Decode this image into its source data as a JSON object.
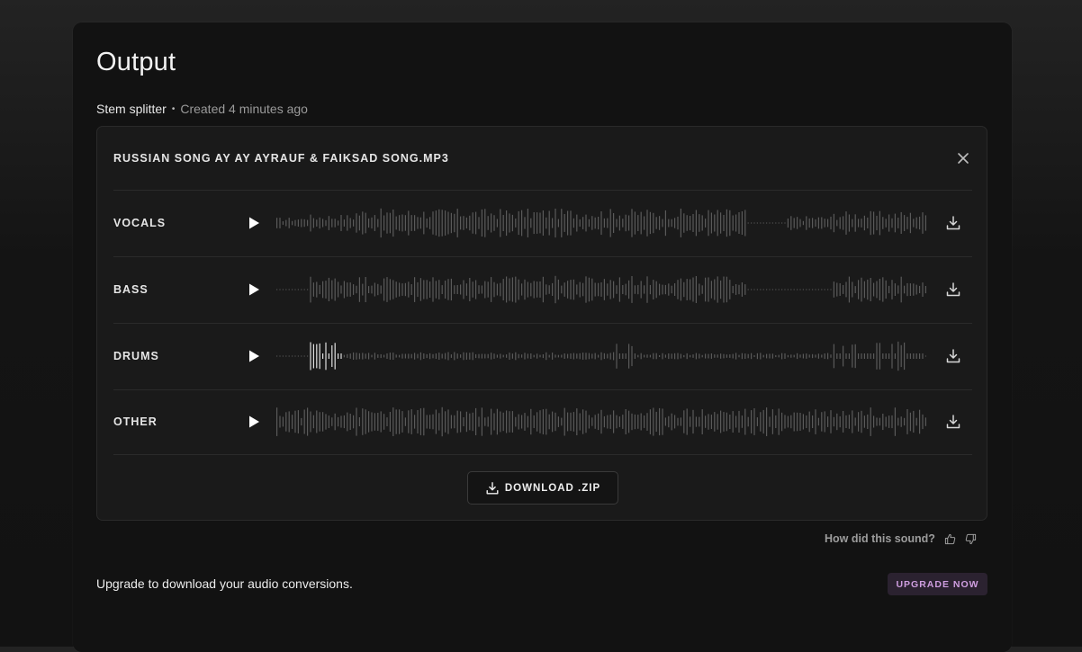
{
  "page": {
    "title": "Output",
    "tool_name": "Stem splitter",
    "separator": "•",
    "created": "Created 4 minutes ago"
  },
  "card": {
    "file_name": "RUSSIAN SONG AY AY AYRAUF & FAIKSAD SONG.MP3",
    "close_icon": "close-icon",
    "stems": [
      {
        "label": "VOCALS",
        "play_icon": "play-icon",
        "download_icon": "download-icon"
      },
      {
        "label": "BASS",
        "play_icon": "play-icon",
        "download_icon": "download-icon"
      },
      {
        "label": "DRUMS",
        "play_icon": "play-icon",
        "download_icon": "download-icon"
      },
      {
        "label": "OTHER",
        "play_icon": "play-icon",
        "download_icon": "download-icon"
      }
    ],
    "download_zip_label": "DOWNLOAD .ZIP"
  },
  "feedback": {
    "question": "How did this sound?",
    "thumbs_up_icon": "thumbs-up-icon",
    "thumbs_down_icon": "thumbs-down-icon"
  },
  "upgrade": {
    "message": "Upgrade to download your audio conversions.",
    "button_label": "UPGRADE NOW"
  },
  "colors": {
    "background": "#121212",
    "card": "#1a1a1a",
    "waveform": "#5a5a5a",
    "waveform_highlight": "#e0e0e0",
    "upgrade_bg": "#2b2230",
    "upgrade_text": "#cf9ee0"
  }
}
